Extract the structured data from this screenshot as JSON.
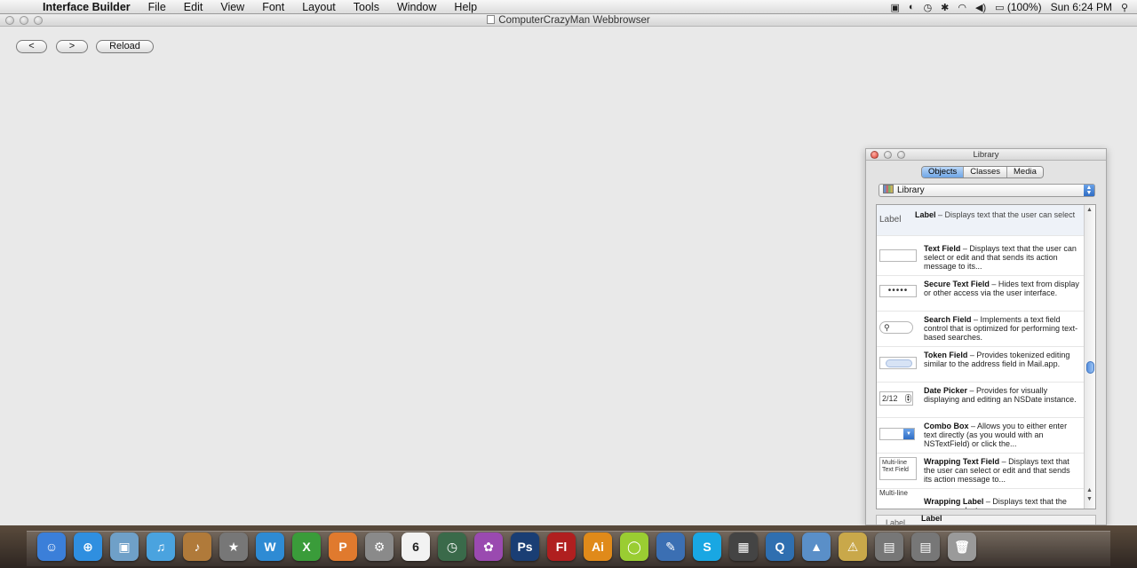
{
  "menubar": {
    "apple_glyph": "",
    "items": [
      "Interface Builder",
      "File",
      "Edit",
      "View",
      "Font",
      "Layout",
      "Tools",
      "Window",
      "Help"
    ],
    "battery": "(100%)",
    "clock": "Sun 6:24 PM",
    "status_icons": [
      "screen-record-icon",
      "sync-icon",
      "time-machine-icon",
      "bluetooth-icon",
      "wifi-icon",
      "volume-icon",
      "battery-icon",
      "spotlight-icon"
    ]
  },
  "window": {
    "title": "ComputerCrazyMan Webbrowser",
    "back_label": "<",
    "forward_label": ">",
    "reload_label": "Reload"
  },
  "library": {
    "title": "Library",
    "tabs": [
      {
        "label": "Objects",
        "active": true
      },
      {
        "label": "Classes",
        "active": false
      },
      {
        "label": "Media",
        "active": false
      }
    ],
    "selector_value": "Library",
    "items": [
      {
        "thumb": "Label",
        "name": "Label",
        "desc": " – Displays text that the user can select"
      },
      {
        "thumb": "",
        "name": "Text Field",
        "desc": " – Displays text that the user can select or edit and that sends its action message to its..."
      },
      {
        "thumb": "•••••",
        "name": "Secure Text Field",
        "desc": " – Hides text from display or other access via the user interface."
      },
      {
        "thumb": "",
        "name": "Search Field",
        "desc": " – Implements a text field control that is optimized for performing text-based searches."
      },
      {
        "thumb": "",
        "name": "Token Field",
        "desc": " – Provides tokenized editing similar to the address field in Mail.app."
      },
      {
        "thumb": "2/12",
        "name": "Date Picker",
        "desc": " – Provides for visually displaying and editing an NSDate instance."
      },
      {
        "thumb": "",
        "name": "Combo Box",
        "desc": " – Allows you to either enter text directly (as you would with an NSTextField) or click the..."
      },
      {
        "thumb": "Multi-line Text Field",
        "name": "Wrapping Text Field",
        "desc": " – Displays text that the user can select or edit and that sends its action message to..."
      },
      {
        "thumb": "Multi-line",
        "name": "Wrapping Label",
        "desc": " – Displays text that the user can select"
      }
    ],
    "bottom": {
      "thumb": "Label",
      "name": "Label"
    }
  },
  "dock": {
    "apps": [
      {
        "name": "finder-icon",
        "glyph": "☺",
        "color": "#3b7fd9"
      },
      {
        "name": "safari-icon",
        "glyph": "⊕",
        "color": "#2f8fe0"
      },
      {
        "name": "preview-icon",
        "glyph": "▣",
        "color": "#6fa0c8"
      },
      {
        "name": "itunes-icon",
        "glyph": "♫",
        "color": "#4aa3df"
      },
      {
        "name": "garageband-icon",
        "glyph": "♪",
        "color": "#b07a3a"
      },
      {
        "name": "imovie-icon",
        "glyph": "★",
        "color": "#777777"
      },
      {
        "name": "word-icon",
        "glyph": "W",
        "color": "#2e8bd4"
      },
      {
        "name": "excel-icon",
        "glyph": "X",
        "color": "#3a9c3a"
      },
      {
        "name": "powerpoint-icon",
        "glyph": "P",
        "color": "#e07a2e"
      },
      {
        "name": "system-prefs-icon",
        "glyph": "⚙",
        "color": "#8a8a8a"
      },
      {
        "name": "ical-icon",
        "glyph": "6",
        "color": "#f2f2f2"
      },
      {
        "name": "time-machine-icon",
        "glyph": "◷",
        "color": "#3a6a4a"
      },
      {
        "name": "photo-booth-icon",
        "glyph": "✿",
        "color": "#9a4ab0"
      },
      {
        "name": "photoshop-icon",
        "glyph": "Ps",
        "color": "#1a3e74"
      },
      {
        "name": "flash-icon",
        "glyph": "Fl",
        "color": "#b01f1f"
      },
      {
        "name": "illustrator-icon",
        "glyph": "Ai",
        "color": "#e08a1a"
      },
      {
        "name": "dreamweaver-icon",
        "glyph": "◯",
        "color": "#9acd32"
      },
      {
        "name": "xcode-icon",
        "glyph": "✎",
        "color": "#3b6fb3"
      },
      {
        "name": "skype-icon",
        "glyph": "S",
        "color": "#19a7e3"
      },
      {
        "name": "clapperboard-icon",
        "glyph": "▦",
        "color": "#444444"
      },
      {
        "name": "quicktime-icon",
        "glyph": "Q",
        "color": "#2f6fb0"
      },
      {
        "name": "iphoto-icon",
        "glyph": "▲",
        "color": "#5a8fc8"
      },
      {
        "name": "instruments-icon",
        "glyph": "⚠",
        "color": "#c9a84a"
      },
      {
        "name": "downloads-stack-icon",
        "glyph": "▤",
        "color": "#777777"
      },
      {
        "name": "documents-stack-icon",
        "glyph": "▤",
        "color": "#777777"
      },
      {
        "name": "trash-icon",
        "glyph": "🗑",
        "color": "#9a9a9a"
      }
    ]
  }
}
